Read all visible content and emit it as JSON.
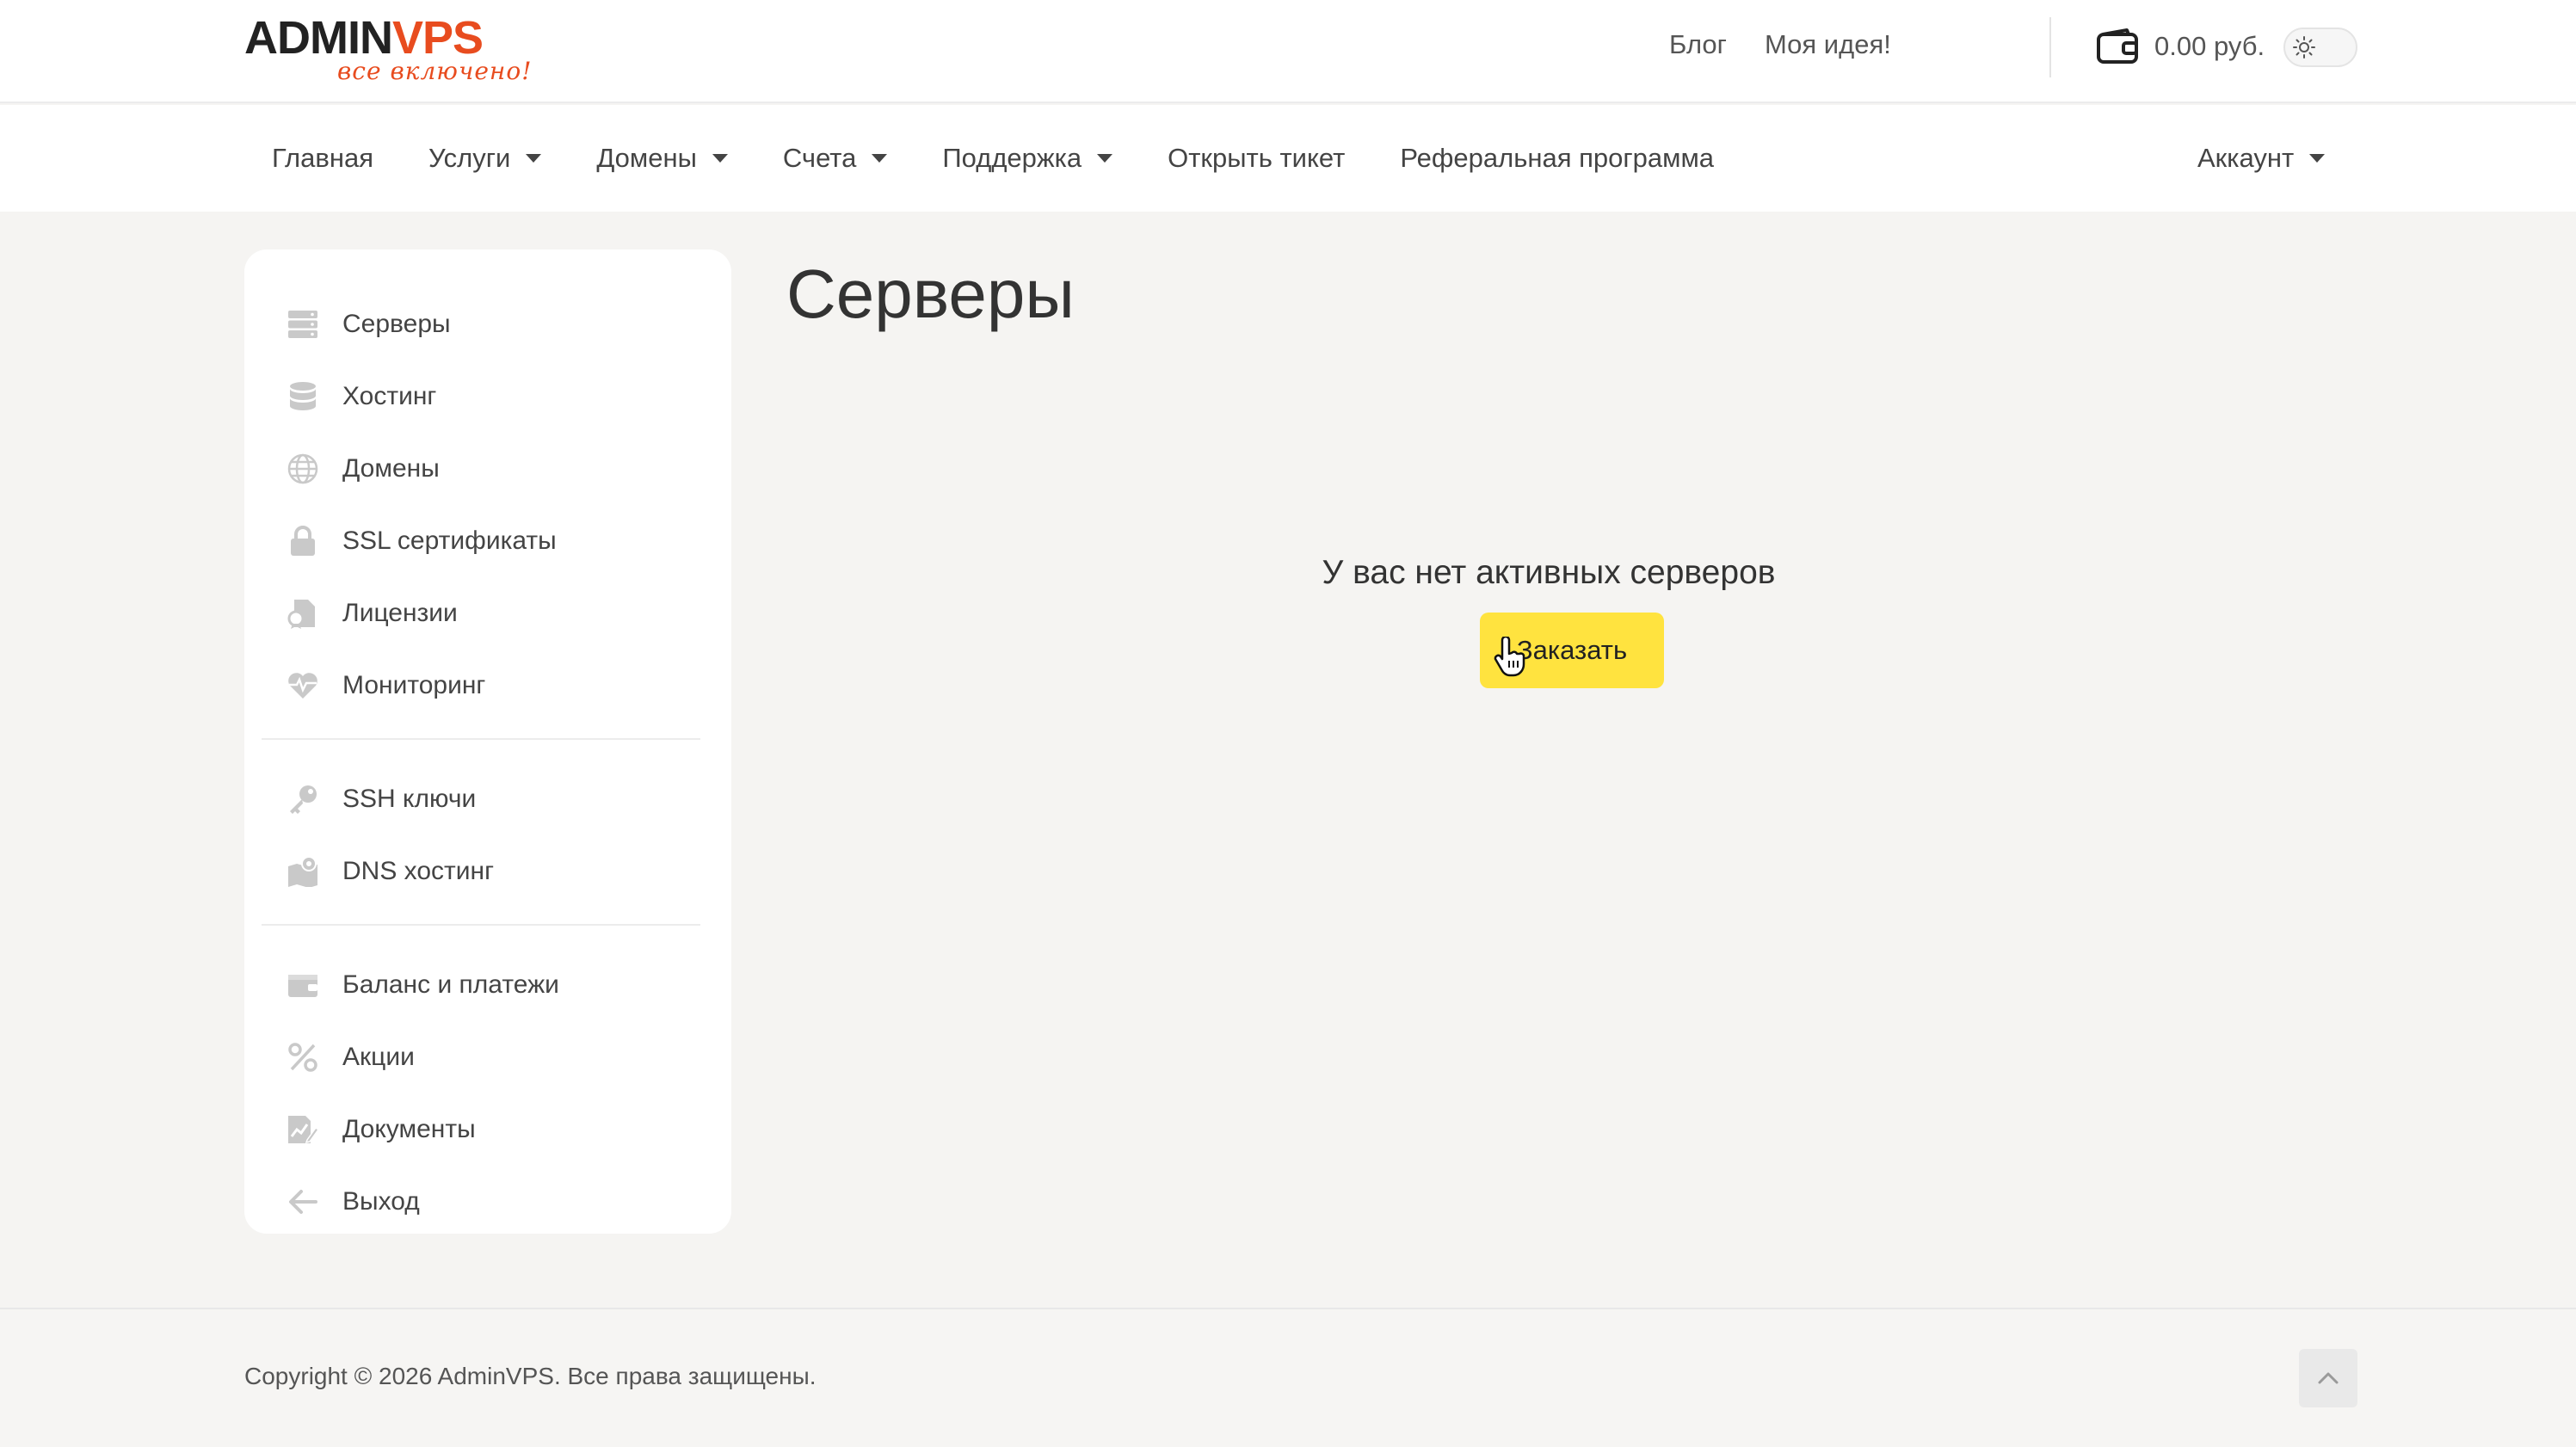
{
  "brand": {
    "logo_admin": "ADMIN",
    "logo_v": "V",
    "logo_ps": "PS",
    "tagline": "все включено!"
  },
  "topbar": {
    "links": [
      "Блог",
      "Моя идея!"
    ],
    "balance": "0.00 руб."
  },
  "nav": {
    "items": [
      {
        "label": "Главная",
        "dropdown": false
      },
      {
        "label": "Услуги",
        "dropdown": true
      },
      {
        "label": "Домены",
        "dropdown": true
      },
      {
        "label": "Счета",
        "dropdown": true
      },
      {
        "label": "Поддержка",
        "dropdown": true
      },
      {
        "label": "Открыть тикет",
        "dropdown": false
      },
      {
        "label": "Реферальная программа",
        "dropdown": false
      }
    ],
    "account": "Аккаунт"
  },
  "sidebar": {
    "items": [
      {
        "label": "Серверы",
        "icon": "server-icon"
      },
      {
        "label": "Хостинг",
        "icon": "database-icon"
      },
      {
        "label": "Домены",
        "icon": "globe-icon"
      },
      {
        "label": "SSL сертификаты",
        "icon": "lock-icon"
      },
      {
        "label": "Лицензии",
        "icon": "license-icon"
      },
      {
        "label": "Мониторинг",
        "icon": "heart-pulse-icon"
      },
      {
        "label": "SSH ключи",
        "icon": "key-icon"
      },
      {
        "label": "DNS хостинг",
        "icon": "dns-map-icon"
      },
      {
        "label": "Баланс и платежи",
        "icon": "wallet-icon"
      },
      {
        "label": "Акции",
        "icon": "percent-icon"
      },
      {
        "label": "Документы",
        "icon": "document-icon"
      },
      {
        "label": "Выход",
        "icon": "arrow-left-icon"
      }
    ]
  },
  "main": {
    "title": "Серверы",
    "empty_message": "У вас нет активных серверов",
    "order_button": "Заказать"
  },
  "footer": {
    "copyright": "Copyright © 2026 AdminVPS. Все права защищены."
  },
  "colors": {
    "accent_yellow": "#ffe33f",
    "brand_orange": "#e84c1f",
    "background": "#f5f4f2"
  }
}
